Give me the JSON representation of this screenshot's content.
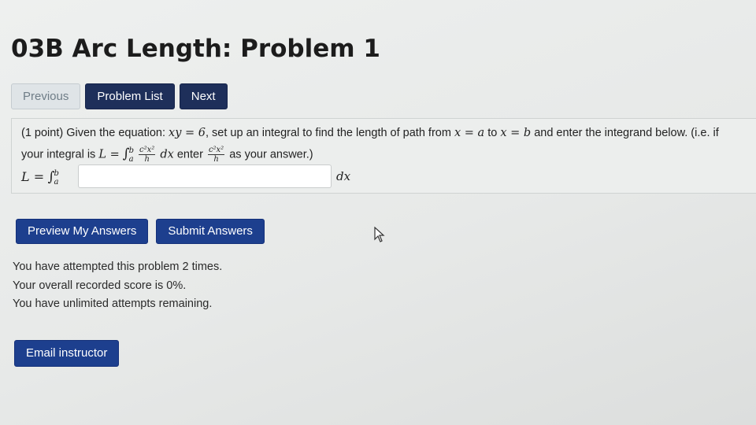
{
  "page": {
    "title": "03B Arc Length: Problem 1"
  },
  "nav": {
    "previous": "Previous",
    "problem_list": "Problem List",
    "next": "Next"
  },
  "problem": {
    "line1_a": "(1 point) Given the equation:",
    "eq": "xy = 6",
    "line1_b": ", set up an integral to find the length of path from",
    "x_eq_a": "x = a",
    "to": "to",
    "x_eq_b": "x = b",
    "line1_c": "and enter the integrand below. (i.e. if",
    "line2_a": "your integral is",
    "L_eq": "L =",
    "int_upper": "b",
    "int_lower": "a",
    "frac_num": "c²x²",
    "frac_den": "h",
    "dx": "dx",
    "enter": "enter",
    "line2_b": "as your answer.)",
    "answer_label": "L =",
    "answer_value": "",
    "answer_dx": "dx"
  },
  "actions": {
    "preview": "Preview My Answers",
    "submit": "Submit Answers"
  },
  "status": {
    "attempts": "You have attempted this problem 2 times.",
    "score": "Your overall recorded score is 0%.",
    "remaining": "You have unlimited attempts remaining."
  },
  "email": {
    "label": "Email instructor"
  },
  "colors": {
    "dark_button": "#1e2f5a",
    "blue_button": "#1d3f8e",
    "disabled_button": "#dfe4e7"
  }
}
